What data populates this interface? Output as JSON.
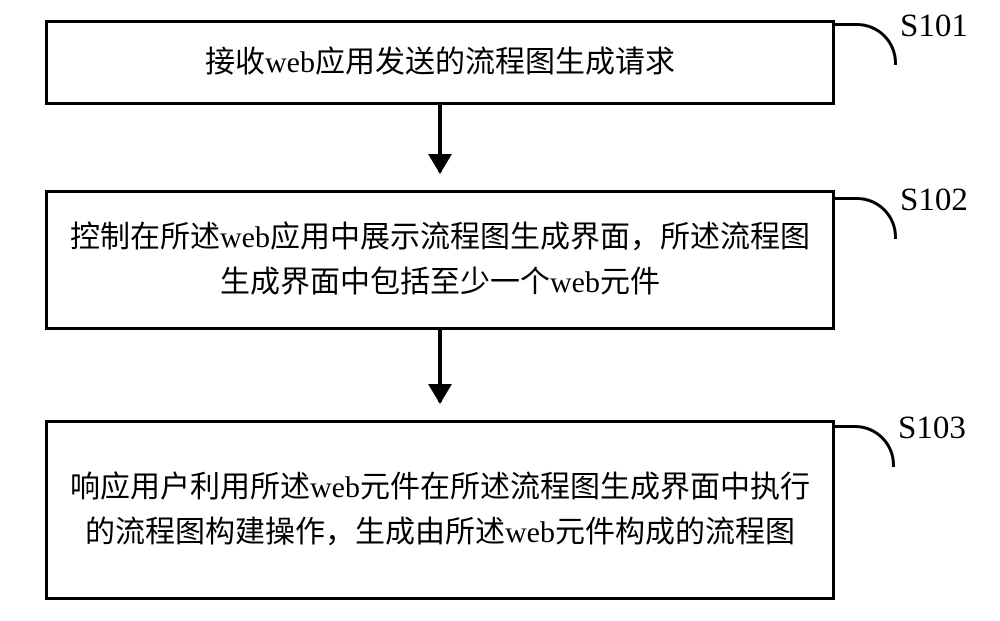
{
  "steps": {
    "step1": {
      "text": "接收web应用发送的流程图生成请求",
      "label": "S101"
    },
    "step2": {
      "text": "控制在所述web应用中展示流程图生成界面，所述流程图生成界面中包括至少一个web元件",
      "label": "S102"
    },
    "step3": {
      "text": "响应用户利用所述web元件在所述流程图生成界面中执行的流程图构建操作，生成由所述web元件构成的流程图",
      "label": "S103"
    }
  }
}
